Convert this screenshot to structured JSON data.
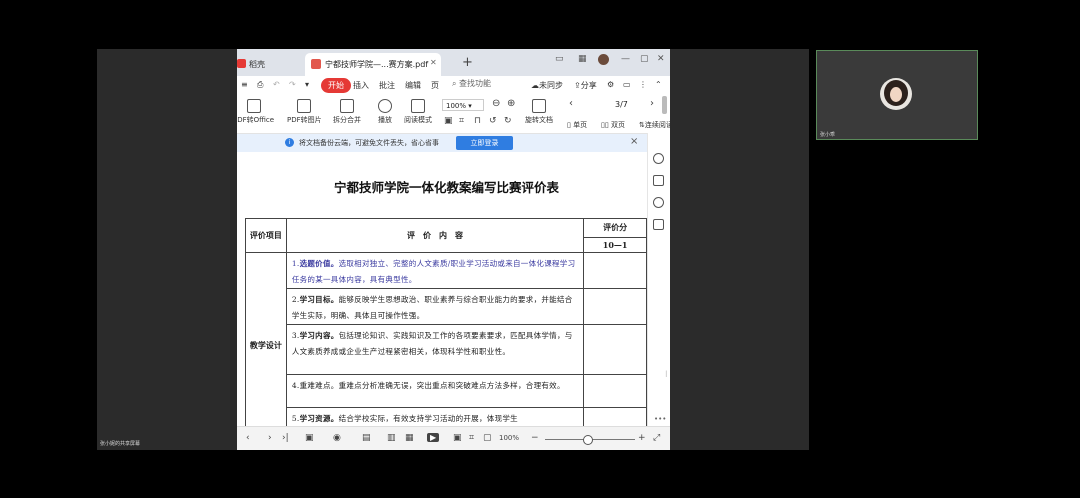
{
  "meeting": {
    "screen_share_caption": "张小妮的共享屏幕",
    "participant_name": "张小乖"
  },
  "app": {
    "tabs": [
      {
        "label": "稻壳"
      },
      {
        "label": "宁都技师学院—...赛方案.pdf"
      }
    ],
    "tab_add": "+",
    "menu": {
      "items": [
        "开始",
        "插入",
        "批注",
        "编辑",
        "页"
      ],
      "search_placeholder": "查找功能",
      "sync_label": "未同步",
      "share_label": "分享"
    },
    "toolbar": {
      "buttons": [
        "PDF转Office",
        "PDF转图片",
        "拆分合并",
        "播放",
        "阅读模式",
        "旋转文档",
        "单页",
        "双页",
        "连续阅读"
      ],
      "zoom": "100%",
      "page_indicator": "3/7"
    },
    "notice": {
      "text": "将文档备份云端，可避免文件丢失，省心省事",
      "button": "立即登录",
      "close": "×"
    },
    "status": {
      "zoom": "100%"
    }
  },
  "document": {
    "title": "宁都技师学院一体化教案编写比赛评价表",
    "table": {
      "header": {
        "item_col": "评价项目",
        "content_col": "评　价　内　容",
        "score_col": "评价分",
        "score_sub": "10—1"
      },
      "group_label": "教学设计",
      "rows": [
        {
          "num": "1.",
          "title": "选题价值。",
          "text": "选取相对独立、完整的人文素质/职业学习活动或来自一体化课程学习任务的某一具体内容，具有典型性。",
          "highlight": true
        },
        {
          "num": "2.",
          "title": "学习目标。",
          "text": "能够反映学生思想政治、职业素养与综合职业能力的要求，并能结合学生实际，明确、具体且可操作性强。",
          "highlight": false
        },
        {
          "num": "3.",
          "title": "学习内容。",
          "text": "包括理论知识、实践知识及工作的各项要素要求，匹配具体学情，与人文素质养成或企业生产过程紧密相关，体现科学性和职业性。",
          "highlight": false
        },
        {
          "num": "4.",
          "title": "重难难点。",
          "text": "重难点分析准确无误，突出重点和突破难点方法多样，合理有效。",
          "highlight": false
        },
        {
          "num": "5.",
          "title": "学习资源。",
          "text": "结合学校实际，有效支持学习活动的开展，体现学生",
          "highlight": false,
          "link": "结合学校实际，"
        }
      ]
    }
  }
}
